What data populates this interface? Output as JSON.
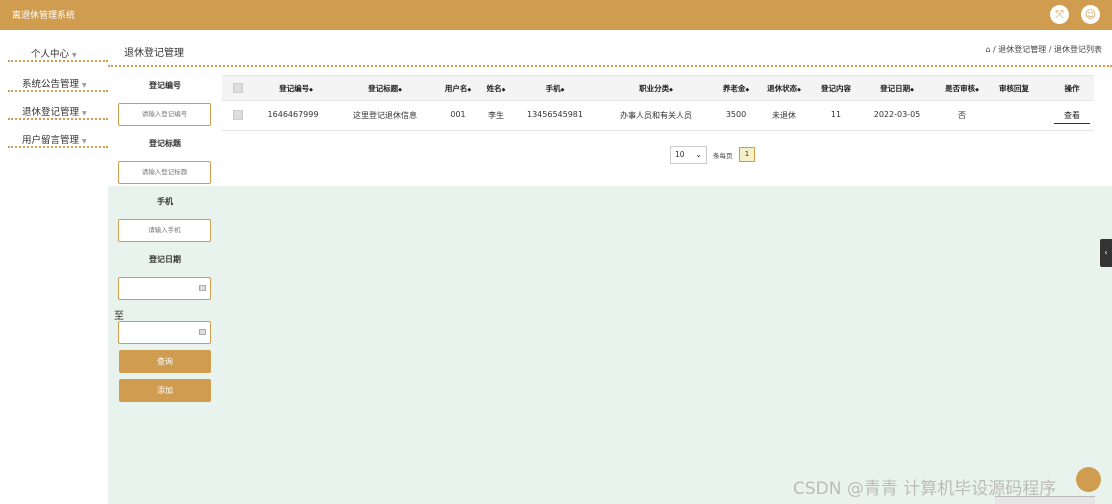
{
  "app": {
    "title": "离退休管理系统"
  },
  "topbar": {
    "fullscreen_icon": "fullscreen-icon",
    "user_icon": "user-icon"
  },
  "sidebar": {
    "items": [
      {
        "label": "个人中心"
      },
      {
        "label": "系统公告管理"
      },
      {
        "label": "退休登记管理"
      },
      {
        "label": "用户留言管理"
      }
    ]
  },
  "header": {
    "title": "退休登记管理",
    "breadcrumb": "/ 退休登记管理 / 退休登记列表"
  },
  "search_form": {
    "fields": [
      {
        "label": "登记编号",
        "placeholder": "请输入登记编号"
      },
      {
        "label": "登记标题",
        "placeholder": "请输入登记标题"
      },
      {
        "label": "手机",
        "placeholder": "请输入手机"
      },
      {
        "label": "登记日期",
        "placeholder": ""
      }
    ],
    "to_label": "至",
    "query_button": "查询",
    "add_button": "添加"
  },
  "table": {
    "columns": [
      "登记编号",
      "登记标题",
      "用户名",
      "姓名",
      "手机",
      "职业分类",
      "养老金",
      "退休状态",
      "登记内容",
      "登记日期",
      "是否审核",
      "审核回复",
      "操作"
    ],
    "sortable": [
      true,
      true,
      true,
      true,
      true,
      true,
      true,
      true,
      true,
      true,
      true,
      false,
      false
    ],
    "rows": [
      {
        "id": "1646467999",
        "title": "这里登记退休信息",
        "username": "001",
        "name": "李生",
        "phone": "13456545981",
        "job": "办事人员和有关人员",
        "pension": "3500",
        "status": "未退休",
        "content": "11",
        "date": "2022-03-05",
        "audited": "否",
        "reply": "",
        "action": "查看"
      }
    ]
  },
  "pagination": {
    "page_size": "10",
    "per_page_label": "条每页",
    "current_page": "1"
  },
  "watermark": "CSDN @青青  计算机毕设源码程序",
  "colors": {
    "accent": "#d09c50",
    "panel": "#e8f3ee"
  }
}
